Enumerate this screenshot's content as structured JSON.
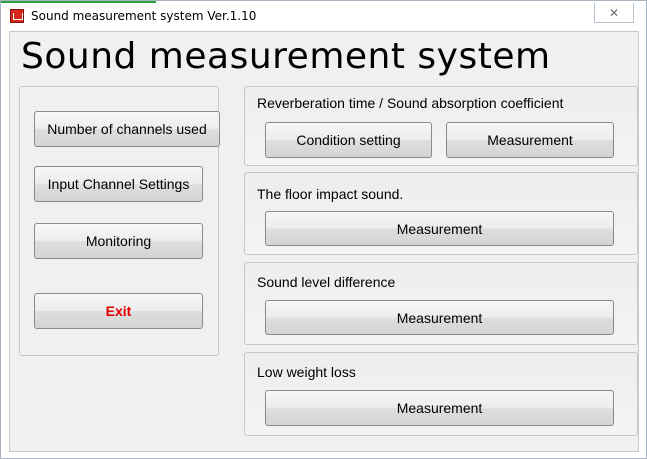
{
  "window": {
    "title": "Sound measurement system Ver.1.10",
    "close_glyph": "✕"
  },
  "app_title": "Sound measurement system",
  "left_panel": {
    "channels_button": "Number of channels used",
    "input_settings_button": "Input Channel Settings",
    "monitoring_button": "Monitoring",
    "exit_button": "Exit"
  },
  "groups": {
    "reverberation": {
      "title": "Reverberation time / Sound absorption coefficient",
      "condition_button": "Condition setting",
      "measurement_button": "Measurement"
    },
    "floor_impact": {
      "title": "The floor impact sound.",
      "measurement_button": "Measurement"
    },
    "sound_level": {
      "title": "Sound level difference",
      "measurement_button": "Measurement"
    },
    "low_weight": {
      "title": "Low weight loss",
      "measurement_button": "Measurement"
    }
  },
  "colors": {
    "exit_text": "#e00000",
    "app_icon": "#d8261b",
    "accent": "#2ea043"
  }
}
